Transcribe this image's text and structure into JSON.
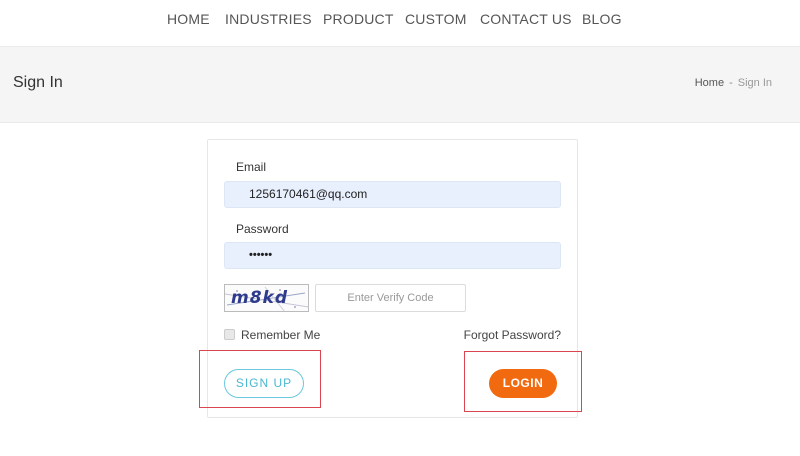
{
  "nav": {
    "items": [
      "HOME",
      "INDUSTRIES",
      "PRODUCT",
      "CUSTOM",
      "CONTACT US",
      "BLOG"
    ]
  },
  "title_bar": {
    "title": "Sign In",
    "breadcrumb": {
      "home": "Home",
      "separator": "-",
      "current": "Sign In"
    }
  },
  "form": {
    "email_label": "Email",
    "email_value": "1256170461@qq.com",
    "password_label": "Password",
    "password_value": "••••••",
    "captcha_text": "m8kd",
    "verify_placeholder": "Enter Verify Code",
    "remember_label": "Remember Me",
    "remember_checked": false,
    "forgot_label": "Forgot Password?",
    "signup_label": "SIGN UP",
    "login_label": "LOGIN"
  },
  "colors": {
    "login_button": "#f26a10",
    "signup_border": "#6cc9de",
    "highlight": "#d9464f",
    "input_fill": "#e8f0fe"
  }
}
